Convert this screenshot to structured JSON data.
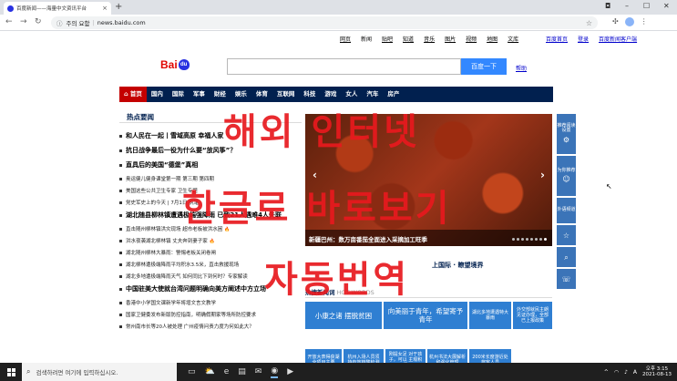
{
  "browser": {
    "tab_title": "百度新闻——海量中文资讯平台",
    "tab_close": "×",
    "new_tab": "+",
    "window_controls": {
      "profile": "◘",
      "minimize": "–",
      "maximize": "☐",
      "close": "✕"
    },
    "address": {
      "security_text": "주의 요함",
      "separator": "|",
      "url": "news.baidu.com"
    },
    "nav": {
      "back": "←",
      "forward": "→",
      "reload": "↻"
    }
  },
  "header": {
    "top_links": [
      "网页",
      "新闻",
      "贴吧",
      "知道",
      "音乐",
      "图片",
      "视频",
      "地图",
      "文库"
    ],
    "right_links": [
      "百度首页",
      "登录",
      "百度新闻客户端"
    ],
    "logo": {
      "bai": "Bai",
      "paw": "du",
      "news": "新闻"
    },
    "search_button": "百度一下",
    "help": "帮助"
  },
  "navbar": {
    "items": [
      "⌂ 首页",
      "国内",
      "国际",
      "军事",
      "财经",
      "娱乐",
      "体育",
      "互联网",
      "科技",
      "游戏",
      "女人",
      "汽车",
      "房产"
    ],
    "active_index": 0
  },
  "hot_news": {
    "title": "热点要闻",
    "items": [
      {
        "text": "和人民在一起丨雪域高原 幸福人家",
        "style": "big"
      },
      {
        "text": "抗日战争最后一役为什么要“放风筝”？",
        "style": "big"
      },
      {
        "text": "直具后的美国“德堡”真相",
        "style": "big"
      },
      {
        "text": "奥运健儿健身课堂第一期 第三期 第四期",
        "style": "small"
      },
      {
        "text": "美国这些公共卫生专家 卫生专题",
        "style": "small"
      },
      {
        "text": "党史军史上的今天 | 7月1日 执笔",
        "style": "small"
      },
      {
        "text": "湖北随县柳林镇遭遇极端强降雨 已致21人遇难4人失联",
        "style": "big"
      },
      {
        "text": "直击随州柳林镇洪灾现场 超市老板被洪水困",
        "style": "small",
        "fire": true
      },
      {
        "text": "洪水夜袭湖北柳林镇 丈夫奔到妻子家",
        "style": "small",
        "fire": true
      },
      {
        "text": "湖北随州柳林大暴雨：警惕老板关闭卷闸",
        "style": "small"
      },
      {
        "text": "湖北柳林遭极端降雨平均积水3.5米，直击救援现场",
        "style": "small"
      },
      {
        "text": "湖北多地遭极端降雨天气 如何同比下到何时？专家解读",
        "style": "small"
      },
      {
        "text": "中国驻美大使就台湾问题明确向美方阐述中方立场",
        "style": "big"
      },
      {
        "text": "香港中小学国文课新学年将增文言文教学",
        "style": "small"
      },
      {
        "text": "国家卫健委发布新版防控指南，明确假期家等场所防控要求",
        "style": "small"
      },
      {
        "text": "常州南市长等20人被处理 广州疫情问责力度为何如此大？",
        "style": "small"
      }
    ]
  },
  "slider": {
    "caption": "新疆巴州：数万亩番茄全面进入采摘加工旺季",
    "prev": "‹",
    "next": "›",
    "dot_count": 8,
    "active_dot": 7
  },
  "world_link": "上国际 · 瞭望境界",
  "hot_search": {
    "title": "热搜新闻词",
    "en": "HOT WORDS"
  },
  "tiles": [
    {
      "text": "小康之诸 摆脱贫困",
      "style": "b1"
    },
    {
      "text": "向美丽于青年，希望寄予青年",
      "style": "b1"
    },
    {
      "text": "湖北多地遭遇特大暴雨",
      "style": "sm"
    },
    {
      "text": "外交部就民主朗见证办理，全部已上报政策",
      "style": "sm"
    },
    {
      "text": "开放大表得获湖全项目主要",
      "style": "sm"
    },
    {
      "text": "杭州入场人员须 持有效核酸检测",
      "style": "sm"
    },
    {
      "text": "刚提女足 对于孩子，可以 主观积极",
      "style": "sm"
    },
    {
      "text": "杭州书法大展解析和强化管理",
      "style": "sm"
    },
    {
      "text": "200米长度游近处 旅客人员",
      "style": "sm"
    }
  ],
  "sidebar": [
    {
      "label": "推荐阅读设置",
      "icon": "⚙"
    },
    {
      "label": "为你推荐",
      "icon": "☺"
    },
    {
      "label": "外语频道",
      "icon": ""
    },
    {
      "label": "",
      "icon": "☆"
    },
    {
      "label": "",
      "icon": "⌕"
    },
    {
      "label": "",
      "icon": "☏"
    }
  ],
  "overlay": {
    "line1": "해외 인터넷",
    "line2": "한글로 바로보기",
    "line3": "자동번역"
  },
  "taskbar": {
    "search_placeholder": "검색하려면 여기에 입력하십시오.",
    "search_icon": "⌕",
    "apps": [
      "▭",
      "⛅",
      "e",
      "▤",
      "✉",
      "◉",
      "▶"
    ],
    "tray": {
      "arrow": "^",
      "wifi": "◠",
      "volume": "♪",
      "ime": "A",
      "time": "오후 3:15",
      "date": "2021-08-13"
    }
  }
}
